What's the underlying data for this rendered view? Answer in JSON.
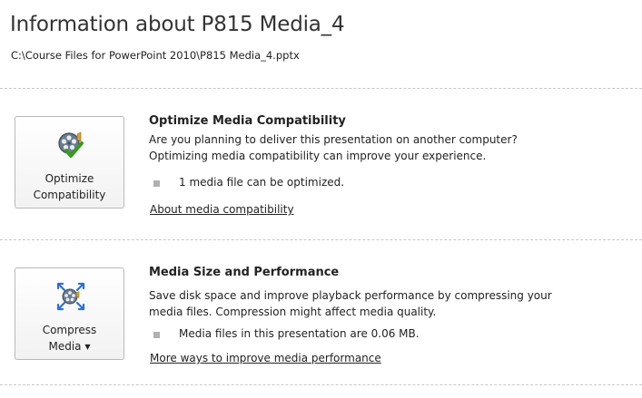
{
  "header": {
    "title": "Information about P815 Media_4",
    "path": "C:\\Course Files for PowerPoint 2010\\P815 Media_4.pptx"
  },
  "optimize": {
    "button_line1": "Optimize",
    "button_line2": "Compatibility",
    "icon": "film-reel-checkmark-icon",
    "title": "Optimize Media Compatibility",
    "description_line1": "Are you planning to deliver this presentation on another computer?",
    "description_line2": "Optimizing media compatibility can improve your experience.",
    "bullet": "1 media file can be optimized.",
    "link": "About media compatibility"
  },
  "compress": {
    "button_line1": "Compress",
    "button_line2": "Media",
    "icon": "film-reel-compress-icon",
    "dropdown_icon": "dropdown-caret-icon",
    "title": "Media Size and Performance",
    "description_line1": "Save disk space and improve playback performance by compressing your",
    "description_line2": "media files. Compression might affect media quality.",
    "bullet": "Media files in this presentation are 0.06 MB.",
    "link": "More ways to improve media performance"
  },
  "colors": {
    "checkmark": "#3a9a1e",
    "arrows": "#2f6fcf",
    "divider": "#c8c8c8",
    "button_border": "#b9b9b9"
  }
}
